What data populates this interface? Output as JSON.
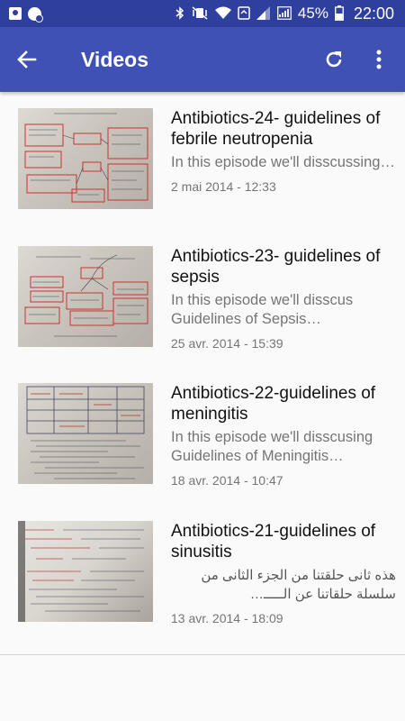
{
  "status_bar": {
    "battery": "45%",
    "time": "22:00"
  },
  "toolbar": {
    "title": "Videos",
    "back_icon": "arrow-back-icon",
    "refresh_icon": "refresh-icon",
    "more_icon": "more-vert-icon"
  },
  "videos": [
    {
      "title": "Antibiotics-24- guidelines of febrile neutropenia",
      "description": "In this episode we'll disscussing…",
      "date": "2 mai 2014 - 12:33"
    },
    {
      "title": "Antibiotics-23- guidelines of sepsis",
      "description": "In this episode we'll disscus Guidelines of Sepsis…",
      "date": "25 avr. 2014 - 15:39"
    },
    {
      "title": "Antibiotics-22-guidelines of meningitis",
      "description": "In this episode we'll disscusing Guidelines of Meningitis…",
      "date": "18 avr. 2014 - 10:47"
    },
    {
      "title": "Antibiotics-21-guidelines of sinusitis",
      "description": "هذه ثانى حلقتنا من الجزء الثانى من سلسلة حلقاتنا عن الـــــ…",
      "date": "13 avr. 2014 - 18:09"
    }
  ]
}
